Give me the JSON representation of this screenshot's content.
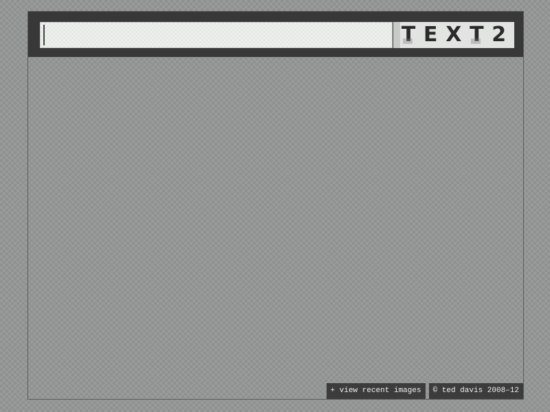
{
  "header": {
    "search": {
      "value": "",
      "placeholder": ""
    },
    "logo": {
      "letters": [
        "T",
        "E",
        "X",
        "T",
        "2"
      ]
    }
  },
  "footer": {
    "recent_link": "+ view recent images",
    "credit": "© ted davis 2008–12"
  },
  "colors": {
    "header_bg": "#383838",
    "footer_bg": "#3c3c3c",
    "field_bg": "#e6e8e6"
  }
}
